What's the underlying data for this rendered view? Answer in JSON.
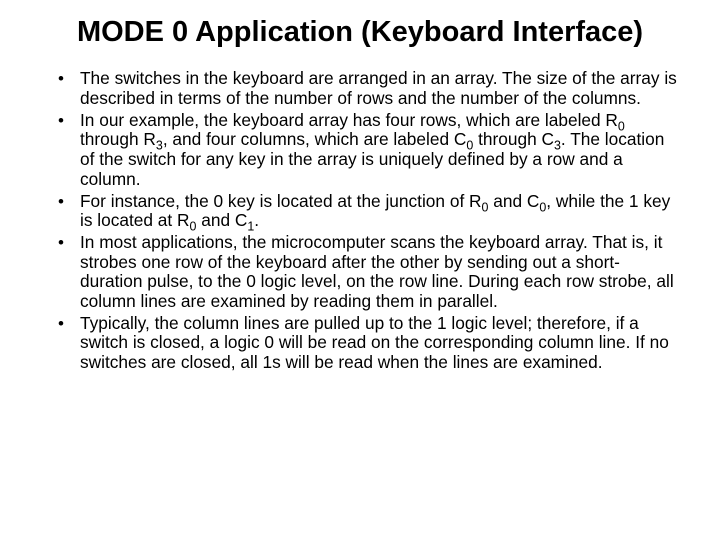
{
  "title": "MODE 0 Application (Keyboard Interface)",
  "bullets": {
    "b0": "The switches in the keyboard are arranged in an array. The size of the array is described in terms of the number of rows and the number of the columns.",
    "b1_a": "In our example, the keyboard array has four rows, which are labeled R",
    "b1_b": " through R",
    "b1_c": ", and four columns, which are labeled C",
    "b1_d": " through C",
    "b1_e": ". The location of the switch for any key in the array is uniquely defined by a row and a column.",
    "b2_a": "For instance, the 0 key is located at the junction of R",
    "b2_b": " and C",
    "b2_c": ", while the 1 key is located at R",
    "b2_d": " and C",
    "b2_e": ".",
    "b3": "In most applications, the microcomputer scans the keyboard array. That is, it strobes  one row of the keyboard after the other by sending out a short-duration pulse, to the 0 logic level, on the row line. During each row strobe, all column lines are examined by reading them in parallel.",
    "b4": "Typically, the column lines are pulled up to the 1 logic level; therefore, if a switch is closed, a logic 0 will be read on the corresponding column line. If no switches are closed, all 1s will be read when the lines are examined.",
    "sub0": "0",
    "sub1": "1",
    "sub3": "3"
  }
}
